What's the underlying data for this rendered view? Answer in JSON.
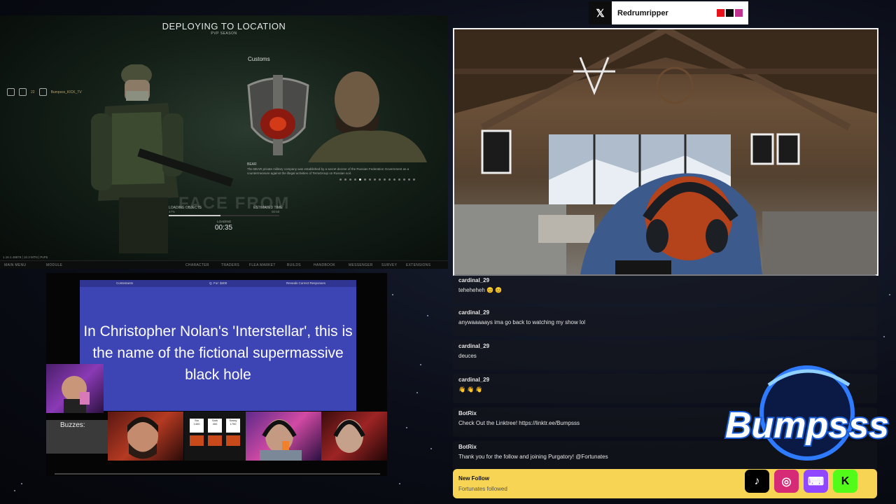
{
  "game": {
    "title": "DEPLOYING TO LOCATION",
    "subtitle": "PVP SEASON",
    "location": "Customs",
    "player_level": "22",
    "player_name": "Bumpsss_KICK_TV",
    "faction_name": "BEAR",
    "faction_description": "The BEAR private military company was established by a secret decree of the Russian Federation Government as a countermeasure against the illegal activities of TerraGroup on Russian soil.",
    "loading_label": "LOADING OBJECTS",
    "loading_value": "47%",
    "loading_progress": 0.47,
    "estimated_label": "ESTIMATED TIME",
    "estimated_value": "00:50",
    "timer_label": "LOADING",
    "timer": "00:35",
    "background_text": "FACE FROM",
    "version_text": "1.16.1.49879 | 10.3 MTN | PvP5",
    "menu": [
      "MAIN MENU",
      "MODULE",
      "CHARACTER",
      "TRADERS",
      "FLEA MARKET",
      "BUILDS",
      "HANDBOOK",
      "MESSENGER",
      "SURVEY",
      "EXTENSIONS"
    ]
  },
  "x_handle": {
    "platform_icon": "x-icon",
    "username": "Redrumripper",
    "swatches": [
      "#e8131a",
      "#0a0a0a",
      "#c2338f"
    ]
  },
  "trivia": {
    "bar_left_label": "Contestants",
    "bar_center_label": "Q. For: $400",
    "bar_right_label": "Reveals Correct Responses",
    "question": "In Christopher Nolan's 'Interstellar', this is the name of the fictional supermassive black hole",
    "buzzes_label": "Buzzes:",
    "scoreboard": [
      {
        "name": "Stu",
        "score": "1400"
      },
      {
        "name": "Sark",
        "score": "400"
      },
      {
        "name": "Sassy",
        "score": "1700"
      }
    ]
  },
  "chat": {
    "messages": [
      {
        "user": "cardinal_29",
        "text": "teheheheh 😊 😊"
      },
      {
        "user": "cardinal_29",
        "text": "anywaaaaays ima go back to watching my show lol"
      },
      {
        "user": "cardinal_29",
        "text": "deuces"
      },
      {
        "user": "cardinal_29",
        "text": "👋 👋 👋"
      },
      {
        "user": "BotRix",
        "text": "Check Out the Linktree! https://linktr.ee/Bumpsss"
      },
      {
        "user": "BotRix",
        "text": "Thank you for the follow and joining Purgatory! @Fortunates"
      }
    ],
    "follow_title": "New Follow",
    "follow_text": "Fortunates followed"
  },
  "brand": {
    "logo_text": "Bumpsss",
    "socials": [
      {
        "icon": "tiktok-icon",
        "glyph": "♪",
        "color": "#000000"
      },
      {
        "icon": "instagram-icon",
        "glyph": "◎",
        "color": "#d62976"
      },
      {
        "icon": "twitch-icon",
        "glyph": "⌨",
        "color": "#9146ff"
      },
      {
        "icon": "kick-icon",
        "glyph": "K",
        "color": "#53fc18"
      }
    ]
  }
}
